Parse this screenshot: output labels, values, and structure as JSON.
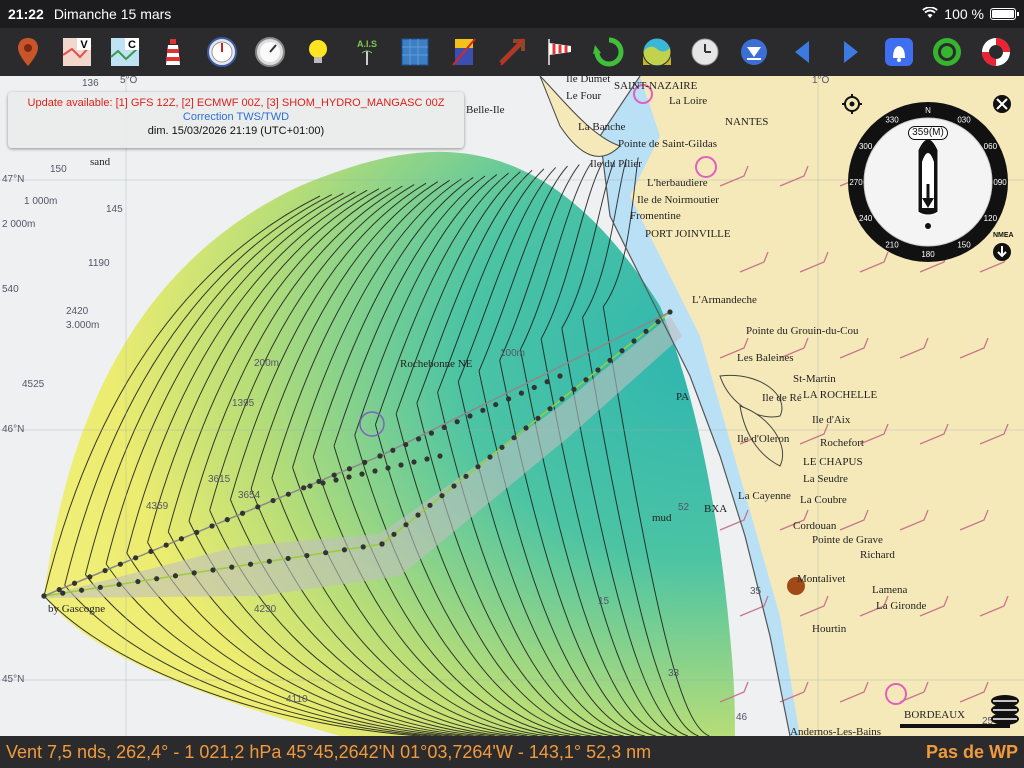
{
  "status": {
    "time": "21:22",
    "date": "Dimanche 15 mars",
    "battery": "100 %",
    "battery_level": 1.0
  },
  "toolbar": {
    "icons": [
      "pin-icon",
      "chart-v-icon",
      "chart-c-icon",
      "lighthouse-icon",
      "gauge-icon",
      "gauge2-icon",
      "lightbulb-icon",
      "ais-icon",
      "grid-icon",
      "flag-icon",
      "route-icon",
      "windsock-icon",
      "refresh-icon",
      "weather-icon",
      "clock-icon",
      "down-arrow-icon",
      "back-icon",
      "forward-icon",
      "alarm-icon",
      "target-icon",
      "lifebuoy-icon"
    ],
    "ais_label": "A.I.S"
  },
  "banner": {
    "line1": "Update available: [1] GFS 12Z, [2] ECMWF 00Z, [3] SHOM_HYDRO_MANGASC 00Z",
    "line2": "Correction TWS/TWD",
    "line3": "dim. 15/03/2026 21:19 (UTC+01:00)"
  },
  "compass": {
    "heading": "359(M)",
    "ticks": [
      "N",
      "030",
      "060",
      "090",
      "120",
      "150",
      "180",
      "210",
      "240",
      "270",
      "300",
      "330"
    ],
    "nmea": "NMEA"
  },
  "map": {
    "places": [
      "SAINT-NAZAIRE",
      "La Loire",
      "NANTES",
      "Pointe de Saint-Gildas",
      "L'herbaudiere",
      "Ile de Noirmoutier",
      "Fromentine",
      "PORT JOINVILLE",
      "L'Armandeche",
      "Pointe du Grouin-du-Cou",
      "Les Baleines",
      "St-Martin",
      "LA ROCHELLE",
      "Ile de Ré",
      "Ile d'Aix",
      "Ile d'Oleron",
      "Rochefort",
      "LE CHAPUS",
      "La Seudre",
      "La Cayenne",
      "La Coubre",
      "Cordouan",
      "Pointe de Grave",
      "Richard",
      "Montalivet",
      "Lamena",
      "La Gironde",
      "Hourtin",
      "BORDEAUX",
      "Andernos-Les-Bains",
      "BXA",
      "PA",
      "Rochebonne NE",
      "Ile Dumet",
      "Le Four",
      "La Banche",
      "Belle-Ile",
      "Ile du Pilier",
      "sand",
      "mud",
      "by Gascogne"
    ],
    "depths": [
      "136",
      "150",
      "145",
      "1190",
      "2420",
      "3.000m",
      "4525",
      "1 000m",
      "2 000m",
      "540",
      "1395",
      "3615",
      "3654",
      "4359",
      "4230",
      "4110",
      "100m",
      "200m",
      "15",
      "35",
      "46",
      "33",
      "52",
      "25"
    ],
    "lat_labels": [
      "47°N",
      "46°N",
      "45°N"
    ],
    "lon_labels": [
      "5°O",
      "1°O"
    ],
    "scale": "25"
  },
  "bottom": {
    "info": "Vent 7,5 nds, 262,4° - 1 021,2 hPa 45°45,2642'N 01°03,7264'W - 143,1° 52,3 nm",
    "waypoint": "Pas de WP"
  }
}
